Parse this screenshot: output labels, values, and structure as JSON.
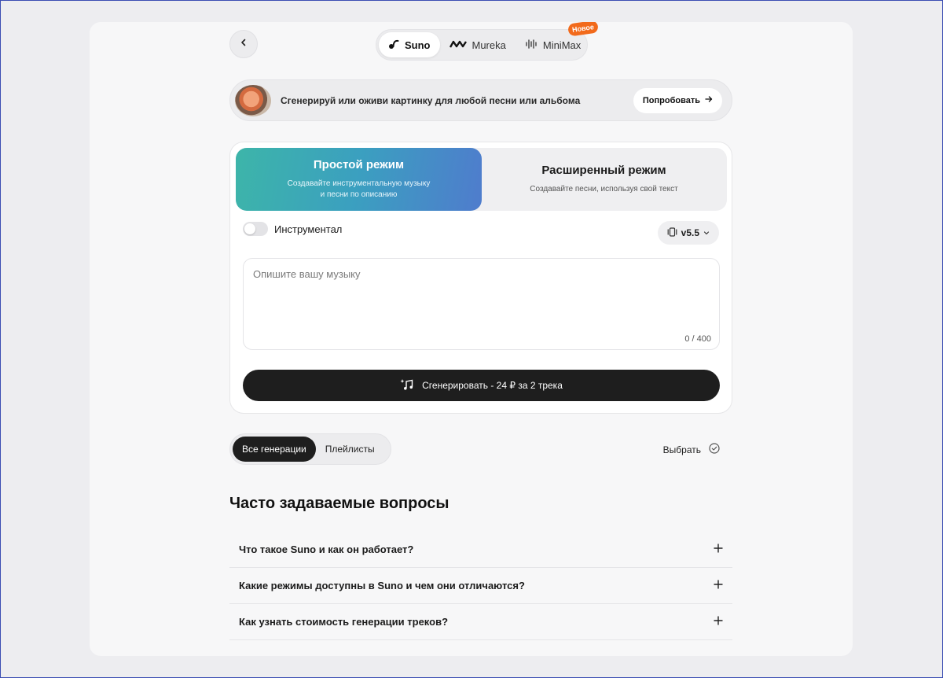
{
  "header": {
    "back_icon": "chevron-left-icon",
    "models": [
      {
        "label": "Suno",
        "icon": "suno-logo-icon",
        "active": true
      },
      {
        "label": "Mureka",
        "icon": "mureka-logo-icon",
        "active": false
      },
      {
        "label": "MiniMax",
        "icon": "minimax-logo-icon",
        "active": false,
        "badge": "Новое"
      }
    ],
    "badge_color": "#f26a1b"
  },
  "promo": {
    "text": "Сгенерируй или оживи картинку для любой песни или альбома",
    "button_label": "Попробовать",
    "button_icon": "arrow-right-icon"
  },
  "generator": {
    "modes": [
      {
        "title": "Простой режим",
        "description": "Создавайте инструментальную музыку и песни по описанию",
        "active": true
      },
      {
        "title": "Расширенный режим",
        "description": "Создавайте песни, используя свой текст",
        "active": false
      }
    ],
    "instrumental_label": "Инструментал",
    "instrumental_on": false,
    "version": "v5.5",
    "prompt_placeholder": "Опишите вашу музыку",
    "char_count": "0 / 400",
    "generate_label": "Сгенерировать - 24 ₽ за 2 трека",
    "accent_gradient": [
      "#3db5a9",
      "#4f7ccd"
    ]
  },
  "library": {
    "tabs": [
      {
        "label": "Все генерации",
        "active": true
      },
      {
        "label": "Плейлисты",
        "active": false
      }
    ],
    "select_label": "Выбрать"
  },
  "faq": {
    "title": "Часто задаваемые вопросы",
    "items": [
      {
        "question": "Что такое Suno и как он работает?"
      },
      {
        "question": "Какие режимы доступны в Suno и чем они отличаются?"
      },
      {
        "question": "Как узнать стоимость генерации треков?"
      }
    ]
  }
}
